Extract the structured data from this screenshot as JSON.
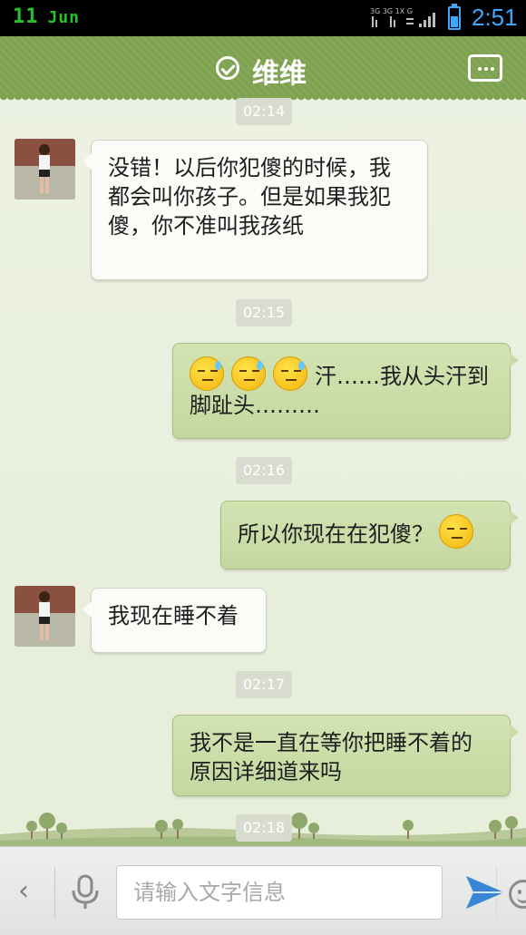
{
  "status_bar": {
    "day": "11",
    "month": "Jun",
    "time": "2:51",
    "network_top": "3G 3G 1X G",
    "accent": "#3aa8ff"
  },
  "header": {
    "title": "维维",
    "bg": "#80a453"
  },
  "messages": [
    {
      "type": "timestamp",
      "text": "02:14"
    },
    {
      "type": "incoming",
      "text": "没错！以后你犯傻的时候，我都会叫你孩子。但是如果我犯傻，你不准叫我孩纸"
    },
    {
      "type": "timestamp",
      "text": "02:15"
    },
    {
      "type": "outgoing",
      "emoji": [
        "sweat-emoji",
        "sweat-emoji",
        "sweat-emoji"
      ],
      "text": "汗……我从头汗到脚趾头………"
    },
    {
      "type": "timestamp",
      "text": "02:16"
    },
    {
      "type": "outgoing",
      "text": "所以你现在在犯傻？",
      "emoji_after": "giggle-emoji"
    },
    {
      "type": "incoming",
      "text": "我现在睡不着"
    },
    {
      "type": "timestamp",
      "text": "02:17"
    },
    {
      "type": "outgoing",
      "text": "我不是一直在等你把睡不着的原因详细道来吗"
    },
    {
      "type": "timestamp",
      "text": "02:18"
    }
  ],
  "input": {
    "placeholder": "请输入文字信息",
    "value": ""
  }
}
